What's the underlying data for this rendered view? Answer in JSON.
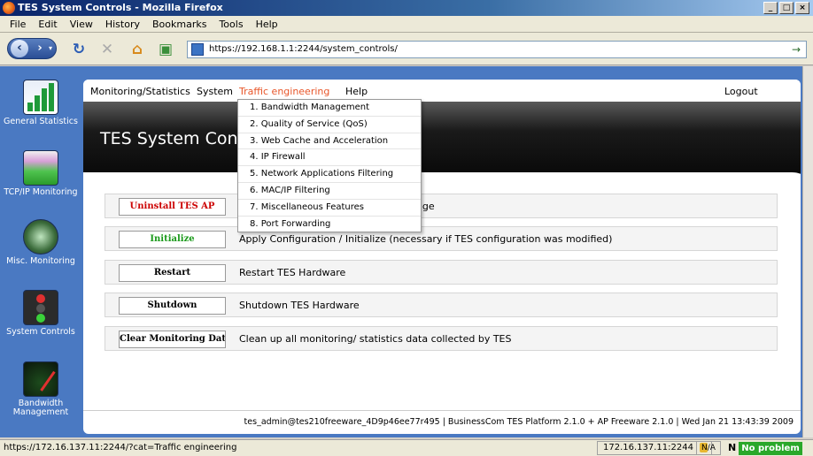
{
  "window": {
    "title": "TES System Controls - Mozilla Firefox",
    "buttons": [
      "_",
      "□",
      "×"
    ]
  },
  "menubar": [
    "File",
    "Edit",
    "View",
    "History",
    "Bookmarks",
    "Tools",
    "Help"
  ],
  "address_bar": {
    "url": "https://192.168.1.1:2244/system_controls/"
  },
  "sidebar": {
    "items": [
      {
        "label": "General Statistics",
        "icon": "bar-chart-icon"
      },
      {
        "label": "TCP/IP Monitoring",
        "icon": "traffic-graph-icon"
      },
      {
        "label": "Misc. Monitoring",
        "icon": "radar-icon"
      },
      {
        "label": "System Controls",
        "icon": "traffic-light-icon"
      },
      {
        "label": "Bandwidth Management",
        "icon": "gauge-icon"
      }
    ]
  },
  "topnav": {
    "items": [
      "Monitoring/Statistics",
      "System",
      "Traffic engineering",
      "Help"
    ],
    "active": "Traffic engineering",
    "logout": "Logout"
  },
  "banner_title": "TES System Contr",
  "dropdown": {
    "items": [
      "1. Bandwidth Management",
      "2. Quality of Service (QoS)",
      "3. Web Cache and Acceleration",
      "4. IP Firewall",
      "5. Network Applications Filtering",
      "6. MAC/IP Filtering",
      "7. Miscellaneous Features",
      "8. Port Forwarding"
    ]
  },
  "actions": [
    {
      "button": "Uninstall TES AP",
      "color": "#cc0000",
      "description": "kage"
    },
    {
      "button": "Initialize",
      "color": "#1a9a1a",
      "description": "Apply Configuration / Initialize (necessary if TES configuration was modified)"
    },
    {
      "button": "Restart",
      "color": "#000000",
      "description": "Restart TES Hardware"
    },
    {
      "button": "Shutdown",
      "color": "#000000",
      "description": "Shutdown TES Hardware"
    },
    {
      "button": "Clear Monitoring Data",
      "color": "#000000",
      "description": "Clean up all monitoring/ statistics data collected by TES"
    }
  ],
  "footer": "tes_admin@tes210freeware_4D9p46ee77r495 | BusinessCom TES Platform 2.1.0 + AP Freeware 2.1.0 | Wed Jan 21 13:43:39 2009",
  "statusbar": {
    "link": "https://172.16.137.11:2244/?cat=Traffic engineering",
    "ip": "172.16.137.11:2244",
    "na": "N/A",
    "n_label": "N",
    "status": "No problem"
  },
  "colors": {
    "sidebar_bg": "#4a79c2",
    "active_nav": "#e8562a",
    "status_ok": "#2aa82a"
  }
}
